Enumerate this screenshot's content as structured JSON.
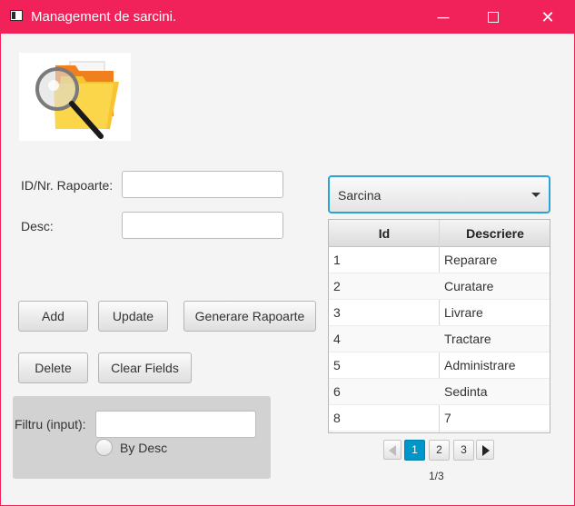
{
  "window": {
    "title": "Management de sarcini.",
    "minimize": "─",
    "close": "✕"
  },
  "form": {
    "id_label": "ID/Nr. Rapoarte:",
    "id_value": "",
    "desc_label": "Desc:",
    "desc_value": ""
  },
  "buttons": {
    "add": "Add",
    "update": "Update",
    "generate": "Generare Rapoarte",
    "delete": "Delete",
    "clear": "Clear Fields"
  },
  "filter": {
    "label": "Filtru (input):",
    "value": "",
    "radio_label": "By Desc",
    "radio_checked": false
  },
  "combo": {
    "selected": "Sarcina"
  },
  "table": {
    "headers": {
      "id": "Id",
      "desc": "Descriere"
    },
    "rows": [
      {
        "id": "1",
        "desc": "Reparare"
      },
      {
        "id": "2",
        "desc": "Curatare"
      },
      {
        "id": "3",
        "desc": "Livrare"
      },
      {
        "id": "4",
        "desc": "Tractare"
      },
      {
        "id": "5",
        "desc": "Administrare"
      },
      {
        "id": "6",
        "desc": "Sedinta"
      },
      {
        "id": "8",
        "desc": "7"
      }
    ]
  },
  "pagination": {
    "pages": [
      "1",
      "2",
      "3"
    ],
    "current": 1,
    "info": "1/3"
  },
  "colors": {
    "titlebar": "#f1215a",
    "accent": "#0096c9",
    "focus": "#2ba3d8"
  }
}
